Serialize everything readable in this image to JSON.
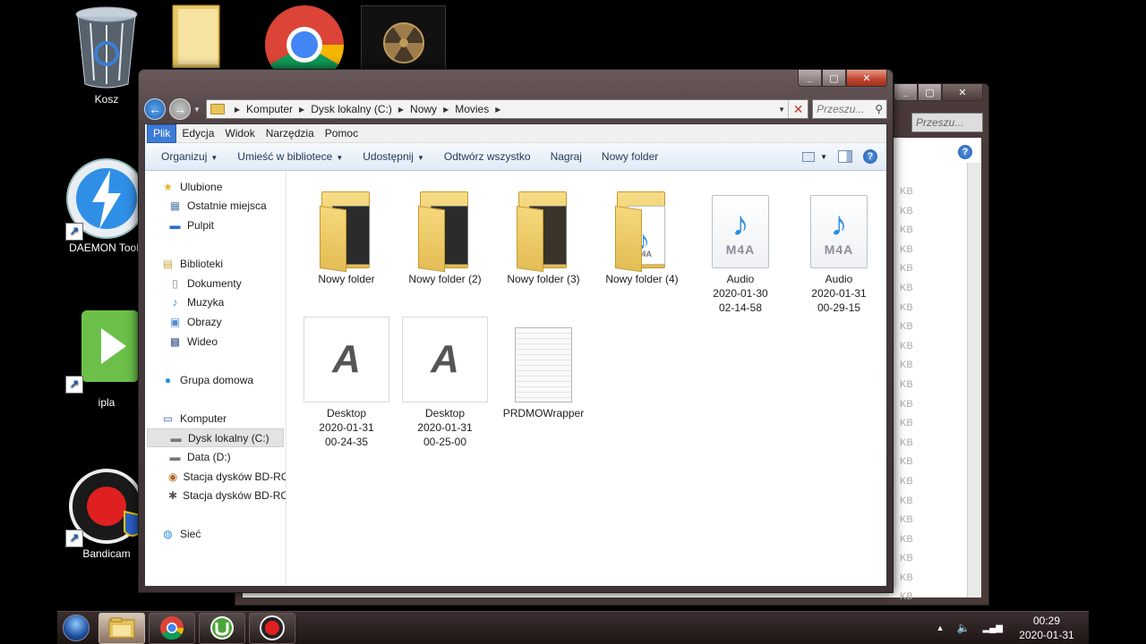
{
  "desktop": {
    "icons": [
      {
        "label": "Kosz",
        "icon": "recycle-bin-icon"
      },
      {
        "label": "DAEMON Tools",
        "icon": "daemon-tools-icon"
      },
      {
        "label": "ipla",
        "icon": "ipla-icon"
      },
      {
        "label": "Bandicam",
        "icon": "bandicam-icon"
      }
    ]
  },
  "back_window": {
    "search_placeholder": "Przeszu...",
    "size_unit": "KB"
  },
  "window": {
    "address": {
      "crumbs": [
        "Komputer",
        "Dysk lokalny (C:)",
        "Nowy",
        "Movies"
      ]
    },
    "search_placeholder": "Przeszu...",
    "menu": [
      "Plik",
      "Edycja",
      "Widok",
      "Narzędzia",
      "Pomoc"
    ],
    "toolbar": {
      "organize": "Organizuj",
      "library": "Umieść w bibliotece",
      "share": "Udostępnij",
      "play_all": "Odtwórz wszystko",
      "burn": "Nagraj",
      "new_folder": "Nowy folder"
    },
    "nav": {
      "favorites": "Ulubione",
      "recent": "Ostatnie miejsca",
      "desktop": "Pulpit",
      "libraries": "Biblioteki",
      "documents": "Dokumenty",
      "music": "Muzyka",
      "pictures": "Obrazy",
      "videos": "Wideo",
      "homegroup": "Grupa domowa",
      "computer": "Komputer",
      "drive_c": "Dysk lokalny (C:)",
      "drive_d": "Data (D:)",
      "bd1": "Stacja dysków BD-RO",
      "bd2": "Stacja dysków BD-RO",
      "network": "Sieć"
    },
    "files": [
      {
        "line1": "Nowy folder",
        "line2": "",
        "line3": "",
        "type": "folder-dark"
      },
      {
        "line1": "Nowy folder (2)",
        "line2": "",
        "line3": "",
        "type": "folder-dark"
      },
      {
        "line1": "Nowy folder (3)",
        "line2": "",
        "line3": "",
        "type": "folder-dark"
      },
      {
        "line1": "Nowy folder (4)",
        "line2": "",
        "line3": "",
        "type": "folder-audio"
      },
      {
        "line1": "Audio",
        "line2": "2020-01-30",
        "line3": "02-14-58",
        "type": "m4a"
      },
      {
        "line1": "Audio",
        "line2": "2020-01-31",
        "line3": "00-29-15",
        "type": "m4a"
      },
      {
        "line1": "Desktop",
        "line2": "2020-01-31",
        "line3": "00-24-35",
        "type": "video"
      },
      {
        "line1": "Desktop",
        "line2": "2020-01-31",
        "line3": "00-25-00",
        "type": "video"
      },
      {
        "line1": "PRDMOWrapper",
        "line2": "",
        "line3": "",
        "type": "text"
      }
    ],
    "m4a_label": "M4A",
    "folder_m4a_label": "M4A"
  },
  "taskbar": {
    "time": "00:29",
    "date": "2020-01-31"
  }
}
